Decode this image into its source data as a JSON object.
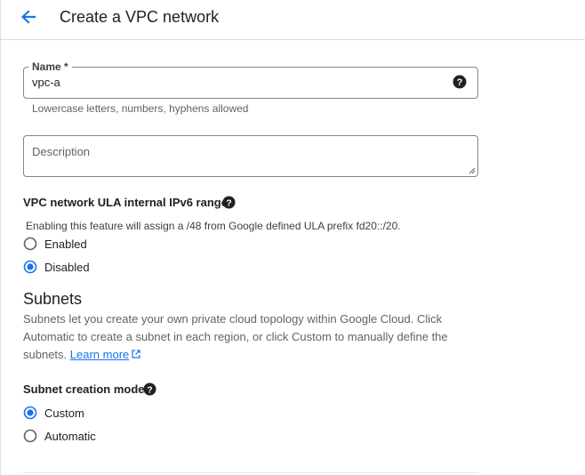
{
  "header": {
    "title": "Create a VPC network"
  },
  "form": {
    "name": {
      "label": "Name *",
      "value": "vpc-a",
      "hint": "Lowercase letters, numbers, hyphens allowed"
    },
    "description": {
      "placeholder": "Description"
    },
    "ipv6": {
      "label": "VPC network ULA internal IPv6 range",
      "description": "Enabling this feature will assign a /48 from Google defined ULA prefix fd20::/20.",
      "options": [
        {
          "label": "Enabled",
          "selected": false
        },
        {
          "label": "Disabled",
          "selected": true
        }
      ]
    },
    "subnets": {
      "heading": "Subnets",
      "description": "Subnets let you create your own private cloud topology within Google Cloud. Click Automatic to create a subnet in each region, or click Custom to manually define the subnets.",
      "learn_more": "Learn more",
      "mode_label": "Subnet creation mode",
      "modes": [
        {
          "label": "Custom",
          "selected": true
        },
        {
          "label": "Automatic",
          "selected": false
        }
      ]
    }
  },
  "colors": {
    "accent": "#1a73e8",
    "text": "#202124",
    "secondary_text": "#5f6368",
    "border": "#80868b"
  },
  "icons": {
    "back": "arrow-back-icon",
    "help": "help-circle-icon",
    "external": "open-in-new-icon"
  }
}
